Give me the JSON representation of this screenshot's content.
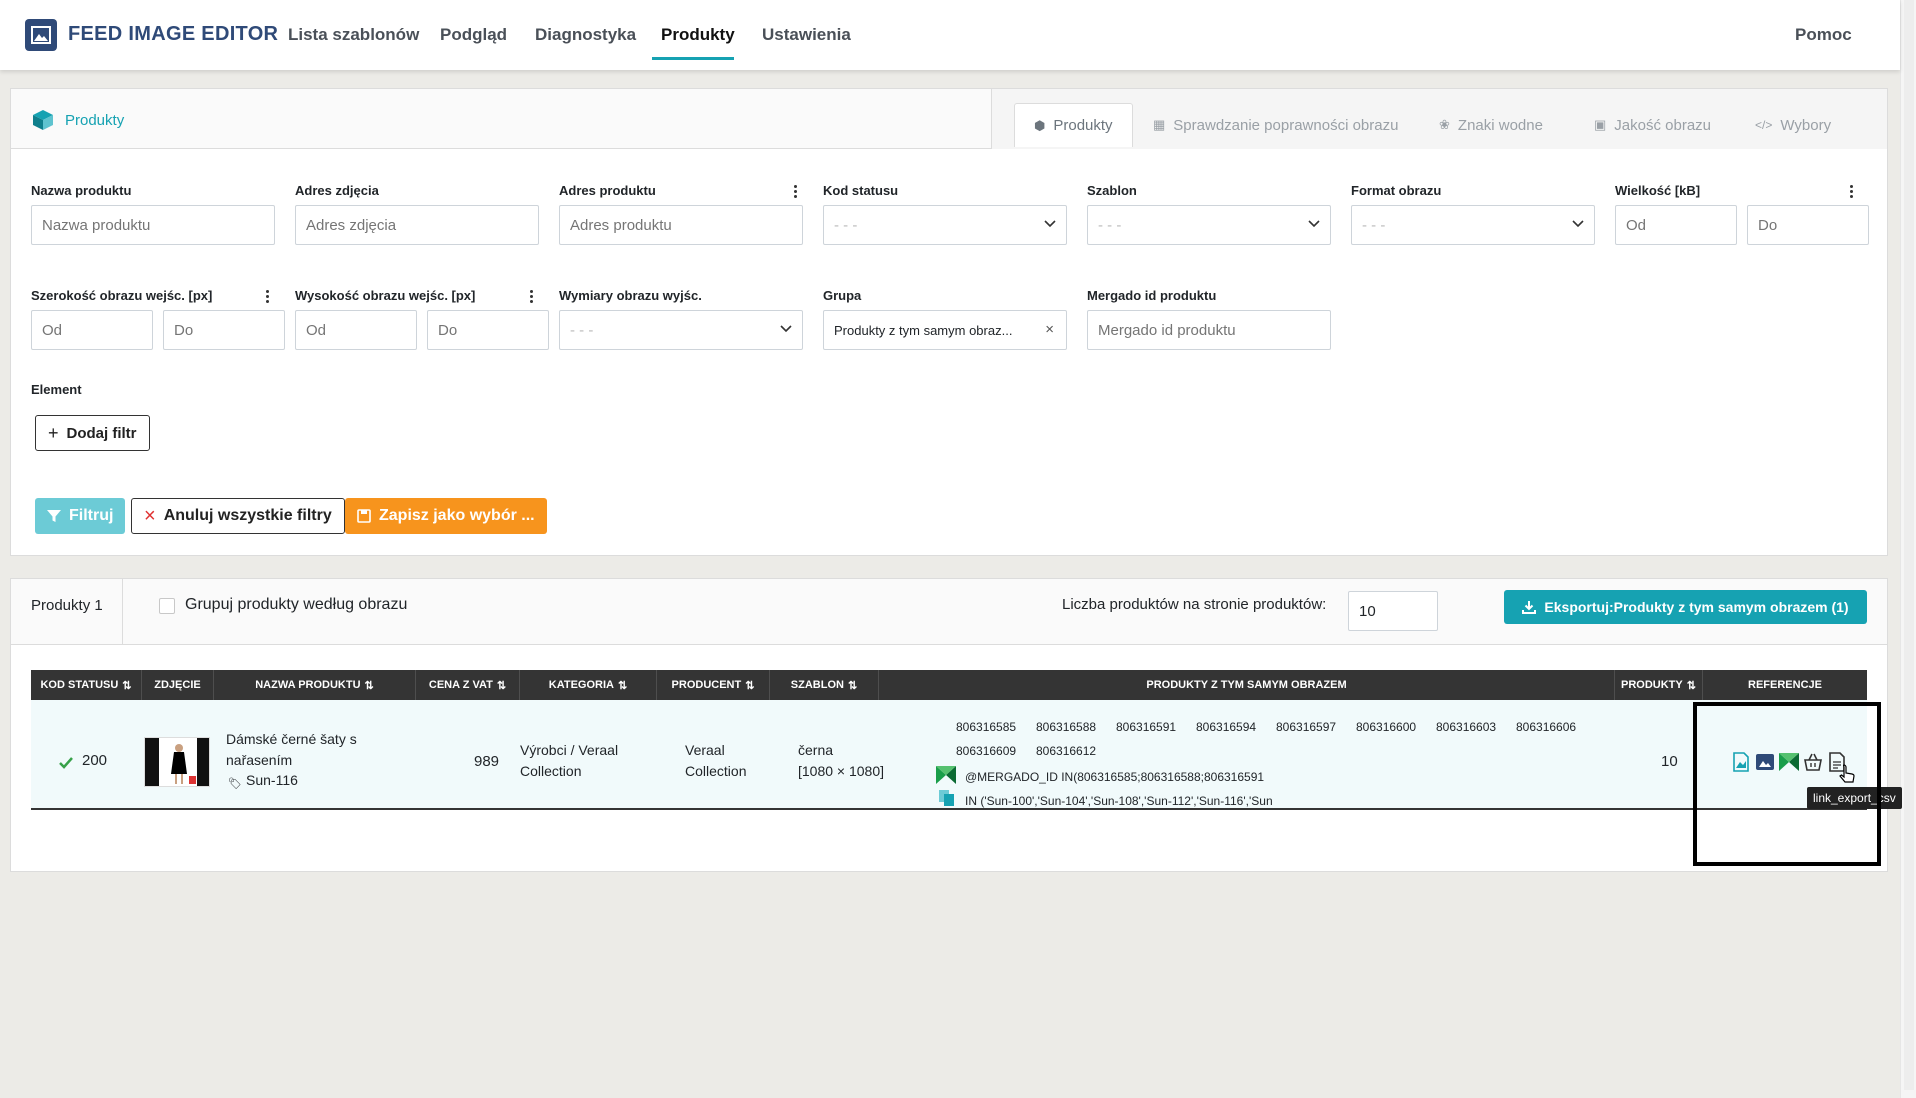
{
  "nav": {
    "brand": "FEED IMAGE EDITOR",
    "items": [
      "Lista szablonów",
      "Podgląd",
      "Diagnostyka",
      "Produkty",
      "Ustawienia"
    ],
    "help": "Pomoc"
  },
  "filters_card": {
    "title": "Produkty",
    "tabs": [
      "Produkty",
      "Sprawdzanie poprawności obrazu",
      "Znaki wodne",
      "Jakość obrazu",
      "Wybory"
    ],
    "fields": {
      "product_name": {
        "label": "Nazwa produktu",
        "placeholder": "Nazwa produktu"
      },
      "image_url": {
        "label": "Adres zdjęcia",
        "placeholder": "Adres zdjęcia"
      },
      "product_url": {
        "label": "Adres produktu",
        "placeholder": "Adres produktu"
      },
      "status_code": {
        "label": "Kod statusu",
        "value": "- - -"
      },
      "template": {
        "label": "Szablon",
        "value": "- - -"
      },
      "image_format": {
        "label": "Format obrazu",
        "value": "- - -"
      },
      "size": {
        "label": "Wielkość [kB]",
        "from": "Od",
        "to": "Do"
      },
      "input_width": {
        "label": "Szerokość obrazu wejśc. [px]",
        "from": "Od",
        "to": "Do"
      },
      "input_height": {
        "label": "Wysokość obrazu wejśc. [px]",
        "from": "Od",
        "to": "Do"
      },
      "output_dims": {
        "label": "Wymiary obrazu wyjśc.",
        "value": "- - -"
      },
      "group": {
        "label": "Grupa",
        "value": "Produkty z tym samym obraz..."
      },
      "mergado_id": {
        "label": "Mergado id produktu",
        "placeholder": "Mergado id produktu"
      },
      "element": {
        "label": "Element"
      }
    },
    "add_filter": "Dodaj filtr",
    "filter_btn": "Filtruj",
    "cancel_btn": "Anuluj wszystkie filtry",
    "save_btn": "Zapisz jako wybór ..."
  },
  "results": {
    "count_label": "Produkty 1",
    "group_by_image": "Grupuj produkty według obrazu",
    "per_page_label": "Liczba produktów na stronie produktów:",
    "per_page_value": "10",
    "export_btn": "Eksportuj:Produkty z tym samym obrazem (1)",
    "columns": [
      "KOD STATUSU",
      "ZDJĘCIE",
      "NAZWA PRODUKTU",
      "CENA Z VAT",
      "KATEGORIA",
      "PRODUCENT",
      "SZABLON",
      "PRODUKTY Z TYM SAMYM OBRAZEM",
      "PRODUKTY",
      "REFERENCJE"
    ],
    "row": {
      "status": "200",
      "name_line1": "Dámské černé šaty s",
      "name_line2": "nařasením",
      "sku": "Sun-116",
      "price": "989",
      "category_line1": "Výrobci / Veraal",
      "category_line2": "Collection",
      "producer_line1": "Veraal",
      "producer_line2": "Collection",
      "template_line1": "černa",
      "template_line2": "[1080 × 1080]",
      "same_image_ids": [
        "806316585",
        "806316588",
        "806316591",
        "806316594",
        "806316597",
        "806316600",
        "806316603",
        "806316606",
        "806316609",
        "806316612"
      ],
      "mergado_query": "@MERGADO_ID IN(806316585;806316588;806316591",
      "sku_query": "IN ('Sun-100','Sun-104','Sun-108','Sun-112','Sun-116','Sun",
      "products_count": "10"
    },
    "tooltip": "link_export_csv"
  },
  "colors": {
    "accent": "#16a2b2",
    "brand": "#2f4a78",
    "warning": "#f7941d",
    "header_dark": "#343434"
  }
}
